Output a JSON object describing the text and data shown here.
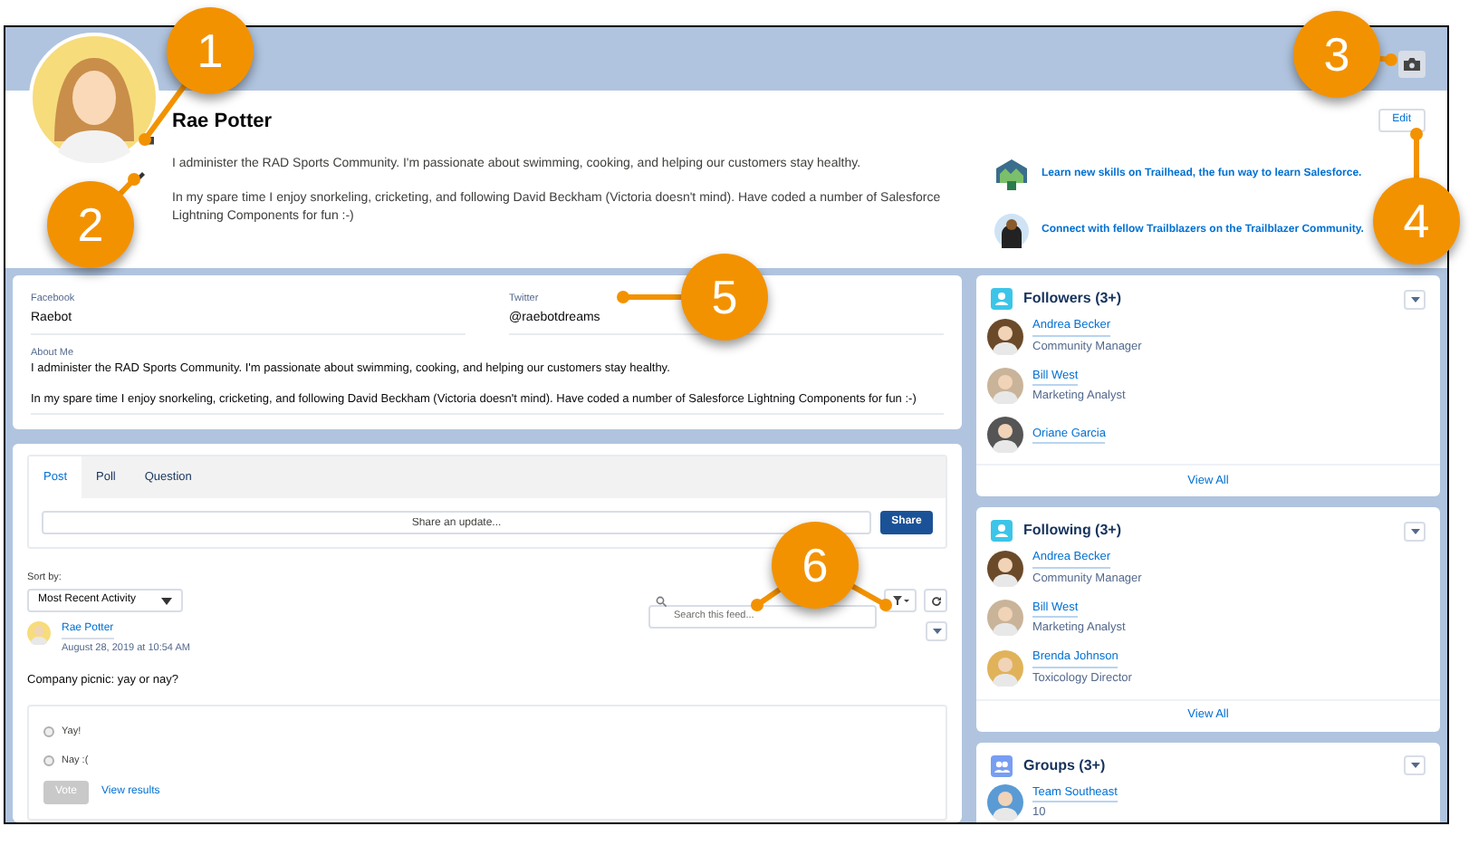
{
  "profile": {
    "name": "Rae Potter",
    "bio": [
      "I administer the RAD Sports Community. I'm passionate about swimming, cooking, and helping our customers stay healthy.",
      "In my spare time I enjoy snorkeling, cricketing, and following David Beckham (Victoria doesn't mind). Have coded a number of Salesforce Lightning Components for fun :-)"
    ],
    "edit_button": "Edit",
    "links": [
      "Learn new skills on Trailhead, the fun way to learn Salesforce.",
      "Connect with fellow Trailblazers on the Trailblazer Community."
    ]
  },
  "about": {
    "fields": [
      {
        "label": "Facebook",
        "value": "Raebot"
      },
      {
        "label": "Twitter",
        "value": "@raebotdreams"
      }
    ],
    "about_me": {
      "label": "About Me",
      "paragraphs": [
        "I administer the RAD Sports Community. I'm passionate about swimming, cooking, and helping our customers stay healthy.",
        "In my spare time I enjoy snorkeling, cricketing, and following David Beckham (Victoria doesn't mind). Have coded a number of Salesforce Lightning Components for fun :-)"
      ]
    }
  },
  "feed": {
    "tabs": [
      {
        "label": "Post",
        "selected": true
      },
      {
        "label": "Poll",
        "selected": false
      },
      {
        "label": "Question",
        "selected": false
      }
    ],
    "share_placeholder": "Share an update...",
    "share_button": "Share",
    "sort_label": "Sort by:",
    "sort_value": "Most Recent Activity",
    "search_placeholder": "Search this feed...",
    "post": {
      "author": "Rae Potter",
      "timestamp": "August 28, 2019 at 10:54 AM",
      "text": "Company picnic: yay or nay?",
      "options": [
        {
          "label": "Yay!",
          "selected": false
        },
        {
          "label": "Nay :(",
          "selected": false
        }
      ],
      "vote_button": "Vote",
      "vote_disabled": true,
      "results_link": "View results"
    }
  },
  "sidebar": [
    {
      "kind": "people",
      "title": "Followers (3+)",
      "items": [
        {
          "name": "Andrea Becker",
          "detail": "Community Manager",
          "color": "#6b4a2a"
        },
        {
          "name": "Bill West",
          "detail": "Marketing Analyst",
          "color": "#c9b49a"
        },
        {
          "name": "Oriane Garcia",
          "color": "#555555"
        }
      ],
      "footer": "View All"
    },
    {
      "kind": "people",
      "title": "Following (3+)",
      "items": [
        {
          "name": "Andrea Becker",
          "detail": "Community Manager",
          "color": "#6b4a2a"
        },
        {
          "name": "Bill West",
          "detail": "Marketing Analyst",
          "color": "#c9b49a"
        },
        {
          "name": "Brenda Johnson",
          "detail": "Toxicology Director",
          "color": "#e0b35a"
        }
      ],
      "footer": "View All"
    },
    {
      "kind": "groups",
      "title": "Groups (3+)",
      "items": [
        {
          "name": "Team Southeast",
          "detail": "10",
          "color": "#5a9bd5"
        }
      ]
    }
  ],
  "callouts": [
    "1",
    "2",
    "3",
    "4",
    "5",
    "6"
  ]
}
